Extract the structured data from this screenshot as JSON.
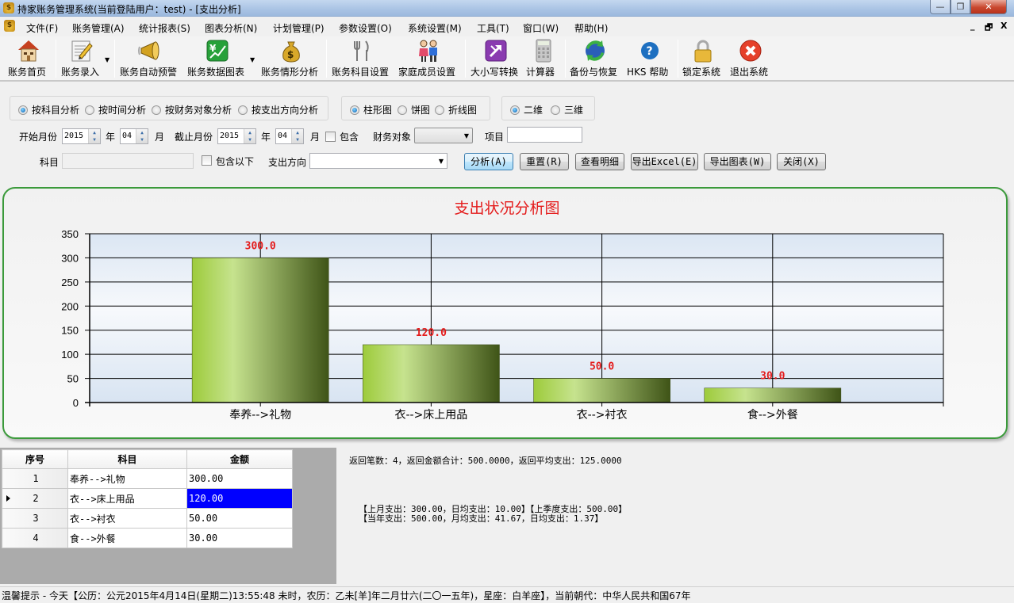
{
  "window": {
    "title": "持家账务管理系统(当前登陆用户：test) - [支出分析]",
    "controls": {
      "minimize": "—",
      "restore": "❐",
      "close": "✕"
    }
  },
  "menubar": {
    "items": [
      "文件(F)",
      "账务管理(A)",
      "统计报表(S)",
      "图表分析(N)",
      "计划管理(P)",
      "参数设置(O)",
      "系统设置(M)",
      "工具(T)",
      "窗口(W)",
      "帮助(H)"
    ],
    "mdi_controls": {
      "minimize": "_",
      "restore": "🗗",
      "close": "X"
    }
  },
  "toolbar": {
    "items": [
      {
        "label": "账务首页",
        "icon": "house-icon"
      },
      {
        "label": "账务录入",
        "icon": "notepad-pencil-icon",
        "dropdown": true
      },
      {
        "label": "账务自动预警",
        "icon": "megaphone-icon"
      },
      {
        "label": "账务数据图表",
        "icon": "yen-chart-icon",
        "dropdown": true
      },
      {
        "label": "账务情形分析",
        "icon": "money-bag-icon"
      },
      {
        "label": "账务科目设置",
        "icon": "fork-knife-icon"
      },
      {
        "label": "家庭成员设置",
        "icon": "couple-icon"
      },
      {
        "label": "大小写转换",
        "icon": "convert-arrow-icon"
      },
      {
        "label": "计算器",
        "icon": "calculator-icon"
      },
      {
        "label": "备份与恢复",
        "icon": "backup-globe-icon"
      },
      {
        "label": "HKS 帮助",
        "icon": "help-icon"
      },
      {
        "label": "锁定系统",
        "icon": "lock-icon"
      },
      {
        "label": "退出系统",
        "icon": "exit-icon"
      }
    ]
  },
  "filters": {
    "analysis_mode": {
      "options": [
        "按科目分析",
        "按时间分析",
        "按财务对象分析",
        "按支出方向分析"
      ],
      "selected": 0
    },
    "chart_type": {
      "options": [
        "柱形图",
        "饼图",
        "折线图"
      ],
      "selected": 0
    },
    "dimension": {
      "options": [
        "二维",
        "三维"
      ],
      "selected": 0
    },
    "start_label": "开始月份",
    "start_year": "2015",
    "year_label": "年",
    "start_month": "04",
    "month_label": "月",
    "end_label": "截止月份",
    "end_year": "2015",
    "end_month": "04",
    "include_label": "包含",
    "include_checked": false,
    "finance_object_label": "财务对象",
    "finance_object_value": "",
    "item_label": "项目",
    "item_value": "",
    "subject_label": "科目",
    "subject_value": "",
    "include_below_label": "包含以下",
    "include_below_checked": false,
    "direction_label": "支出方向",
    "direction_value": ""
  },
  "buttons": {
    "analyze": "分析(A)",
    "reset": "重置(R)",
    "detail": "查看明细",
    "export_excel": "导出Excel(E)",
    "export_chart": "导出图表(W)",
    "close": "关闭(X)"
  },
  "chart_data": {
    "type": "bar",
    "title": "支出状况分析图",
    "categories": [
      "奉养-->礼物",
      "衣-->床上用品",
      "衣-->衬衣",
      "食-->外餐"
    ],
    "values": [
      300.0,
      120.0,
      50.0,
      30.0
    ],
    "data_labels": [
      "300.0",
      "120.0",
      "50.0",
      "30.0"
    ],
    "xlabel": "",
    "ylabel": "",
    "ylim": [
      0,
      350
    ],
    "yticks": [
      0,
      50,
      100,
      150,
      200,
      250,
      300,
      350
    ],
    "grid": true,
    "legend": "none",
    "colors": {
      "bar_light": "#c6e38e",
      "bar_left": "#9dcb3b",
      "bar_dark": "#3f5417",
      "label": "#e41b1b",
      "border": "#3b9a3b"
    }
  },
  "table": {
    "columns": [
      "序号",
      "科目",
      "金额"
    ],
    "rows": [
      {
        "no": "1",
        "subject": "奉养-->礼物",
        "amount": "300.00"
      },
      {
        "no": "2",
        "subject": "衣-->床上用品",
        "amount": "120.00"
      },
      {
        "no": "3",
        "subject": "衣-->衬衣",
        "amount": "50.00"
      },
      {
        "no": "4",
        "subject": "食-->外餐",
        "amount": "30.00"
      }
    ],
    "selected_row": 1
  },
  "summary": {
    "line1": "返回笔数：4，返回金额合计：500.0000，返回平均支出：125.0000",
    "line2": "【上月支出：300.00，日均支出：10.00】【上季度支出：500.00】",
    "line3": "【当年支出：500.00，月均支出：41.67，日均支出：1.37】"
  },
  "statusbar": {
    "text": "温馨提示 - 今天【公历：公元2015年4月14日(星期二)13:55:48 未时，农历：乙未[羊]年二月廿六(二〇一五年)，星座：白羊座】，当前朝代：中华人民共和国67年"
  }
}
